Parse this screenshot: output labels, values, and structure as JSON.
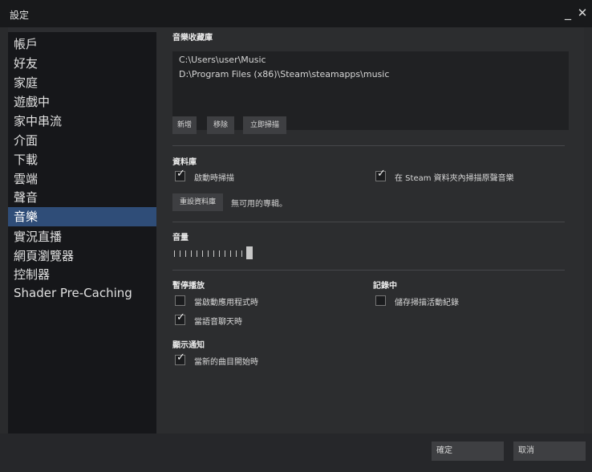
{
  "window": {
    "title": "設定",
    "minimize_glyph": "_",
    "close_glyph": "✕"
  },
  "sidebar": {
    "items": [
      {
        "label": "帳戶",
        "active": false
      },
      {
        "label": "好友",
        "active": false
      },
      {
        "label": "家庭",
        "active": false
      },
      {
        "label": "遊戲中",
        "active": false
      },
      {
        "label": "家中串流",
        "active": false
      },
      {
        "label": "介面",
        "active": false
      },
      {
        "label": "下載",
        "active": false
      },
      {
        "label": "雲端",
        "active": false
      },
      {
        "label": "聲音",
        "active": false
      },
      {
        "label": "音樂",
        "active": true
      },
      {
        "label": "實況直播",
        "active": false
      },
      {
        "label": "網頁瀏覽器",
        "active": false
      },
      {
        "label": "控制器",
        "active": false
      },
      {
        "label": "Shader Pre-Caching",
        "active": false
      }
    ]
  },
  "music_library": {
    "heading": "音樂收藏庫",
    "paths": [
      "C:\\Users\\user\\Music",
      "D:\\Program Files (x86)\\Steam\\steamapps\\music"
    ],
    "buttons": {
      "add": "新增",
      "remove": "移除",
      "scan_now": "立即掃描"
    }
  },
  "library": {
    "heading": "資料庫",
    "scan_on_start": {
      "label": "啟動時掃描",
      "checked": true
    },
    "scan_steam_folder": {
      "label": "在 Steam 資料夾內掃描原聲音樂",
      "checked": true
    },
    "reset_button": "重設資料庫",
    "status": "無可用的專輯。"
  },
  "volume": {
    "heading": "音量",
    "level": 1.0
  },
  "pause": {
    "heading": "暫停播放",
    "on_app_start": {
      "label": "當啟動應用程式時",
      "checked": false
    },
    "on_voice_chat": {
      "label": "當語音聊天時",
      "checked": true
    }
  },
  "logging": {
    "heading": "記錄中",
    "save_scan_log": {
      "label": "儲存掃描活動紀錄",
      "checked": false
    }
  },
  "notifications": {
    "heading": "顯示通知",
    "on_new_track": {
      "label": "當新的曲目開始時",
      "checked": true
    }
  },
  "footer": {
    "ok": "確定",
    "cancel": "取消"
  },
  "check_glyph": "✓"
}
